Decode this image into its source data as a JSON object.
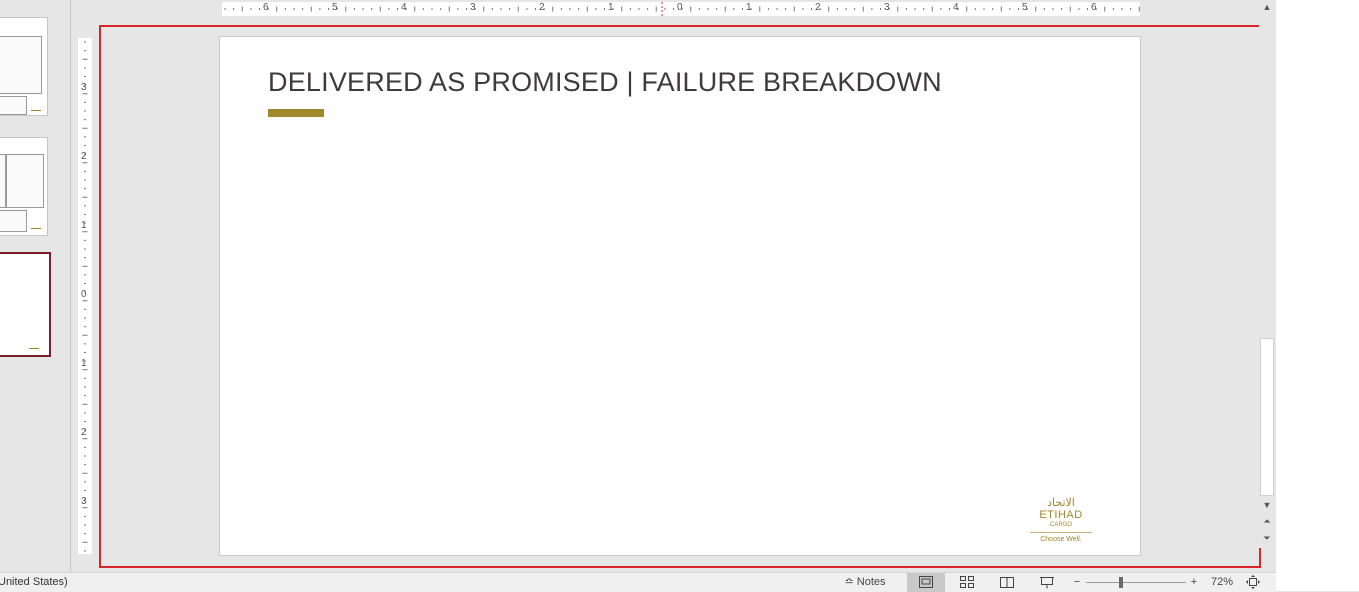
{
  "slide": {
    "title": "DELIVERED AS PROMISED | FAILURE BREAKDOWN",
    "accent_color": "#a08a2c",
    "logo": {
      "arabic": "الاتحاد",
      "wordmark": "ETIHAD",
      "sub": "CARGO",
      "tagline": "Choose Well."
    }
  },
  "ruler": {
    "horizontal_labels": [
      "6",
      "5",
      "4",
      "3",
      "2",
      "1",
      "0",
      "1",
      "2",
      "3",
      "4",
      "5",
      "6"
    ],
    "vertical_labels": [
      "3",
      "2",
      "1",
      "0",
      "1",
      "2",
      "3"
    ]
  },
  "statusbar": {
    "language": "United States)",
    "notes_label": "Notes",
    "zoom_out": "−",
    "zoom_in": "+",
    "zoom_level": "72%"
  },
  "icons": {
    "notes": "notes-icon",
    "normal_view": "normal-view-icon",
    "slide_sorter": "slide-sorter-icon",
    "reading_view": "reading-view-icon",
    "slideshow": "slideshow-icon",
    "fit_slide": "fit-to-window-icon"
  },
  "colors": {
    "selection_border": "#d9262b",
    "active_thumbnail": "#7b1f2b"
  }
}
